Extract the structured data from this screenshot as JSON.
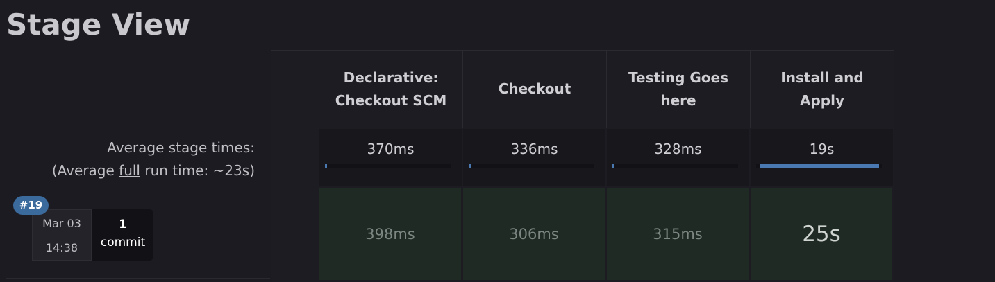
{
  "page": {
    "title": "Stage View"
  },
  "summary": {
    "avg_stage_label": "Average stage times:",
    "avg_full_prefix": "(Average ",
    "avg_full_link": "full",
    "avg_full_suffix": " run time: ~23s)"
  },
  "run": {
    "badge": "#19",
    "date": "Mar 03",
    "time": "14:38",
    "commit_count": "1",
    "commit_label": "commit"
  },
  "stages": [
    {
      "name_line1": "Declarative:",
      "name_line2": "Checkout SCM",
      "avg": "370ms",
      "avg_fraction": 0.015,
      "run": "398ms"
    },
    {
      "name_line1": "Checkout",
      "name_line2": "",
      "avg": "336ms",
      "avg_fraction": 0.015,
      "run": "306ms"
    },
    {
      "name_line1": "Testing Goes",
      "name_line2": "here",
      "avg": "328ms",
      "avg_fraction": 0.015,
      "run": "315ms"
    },
    {
      "name_line1": "Install and",
      "name_line2": "Apply",
      "avg": "19s",
      "avg_fraction": 0.95,
      "run": "25s"
    }
  ],
  "colors": {
    "background": "#1c1b21",
    "badge": "#3b6a9c",
    "progress_fill": "#4a78b0",
    "success_cell": "#1f2a24"
  }
}
